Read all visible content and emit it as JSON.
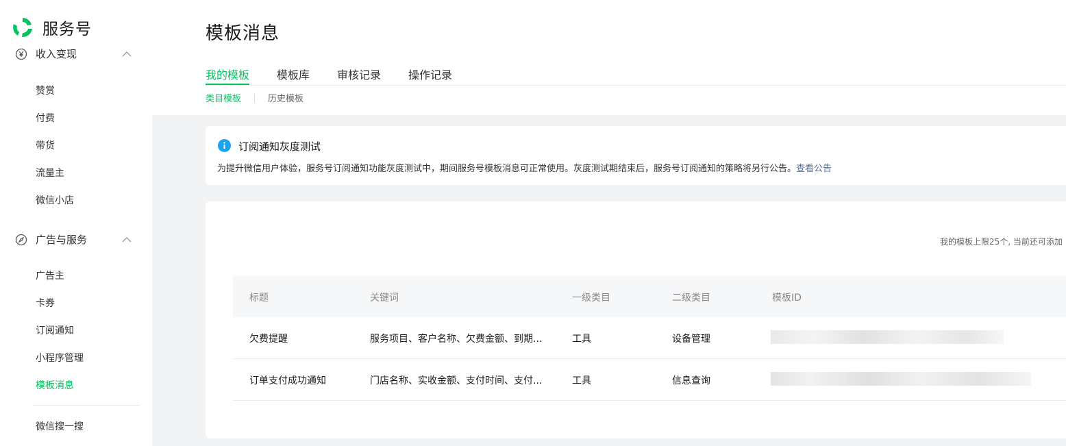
{
  "brand": {
    "name": "服务号",
    "logo_icon": "wechat-service-logo-icon",
    "color": "#07c160"
  },
  "sidebar": {
    "groups": [
      {
        "label": "收入变现",
        "icon": "yen-circle-icon",
        "items": [
          "赞赏",
          "付费",
          "带货",
          "流量主",
          "微信小店"
        ]
      },
      {
        "label": "广告与服务",
        "icon": "compass-icon",
        "items": [
          "广告主",
          "卡券",
          "订阅通知",
          "小程序管理",
          "模板消息"
        ]
      }
    ],
    "active_item": "模板消息",
    "extra_item": "微信搜一搜"
  },
  "page": {
    "title": "模板消息",
    "tabs": [
      "我的模板",
      "模板库",
      "审核记录",
      "操作记录"
    ],
    "active_tab": "我的模板",
    "subtabs": [
      "类目模板",
      "历史模板"
    ],
    "active_subtab": "类目模板"
  },
  "notice": {
    "title": "订阅通知灰度测试",
    "text": "为提升微信用户体验，服务号订阅通知功能灰度测试中，期间服务号模板消息可正常使用。灰度测试期结束后，服务号订阅通知的策略将另行公告。",
    "link": "查看公告"
  },
  "table": {
    "limit_text": "我的模板上限25个, 当前还可添加",
    "headers": [
      "标题",
      "关键词",
      "一级类目",
      "二级类目",
      "模板ID"
    ],
    "rows": [
      {
        "title": "欠费提醒",
        "keywords": "服务项目、客户名称、欠费金额、到期...",
        "cat1": "工具",
        "cat2": "设备管理",
        "template_id": ""
      },
      {
        "title": "订单支付成功通知",
        "keywords": "门店名称、实收金额、支付时间、支付...",
        "cat1": "工具",
        "cat2": "信息查询",
        "template_id": ""
      }
    ]
  },
  "colors": {
    "accent": "#07c160",
    "link": "#576b95",
    "info": "#1aa4f0"
  }
}
